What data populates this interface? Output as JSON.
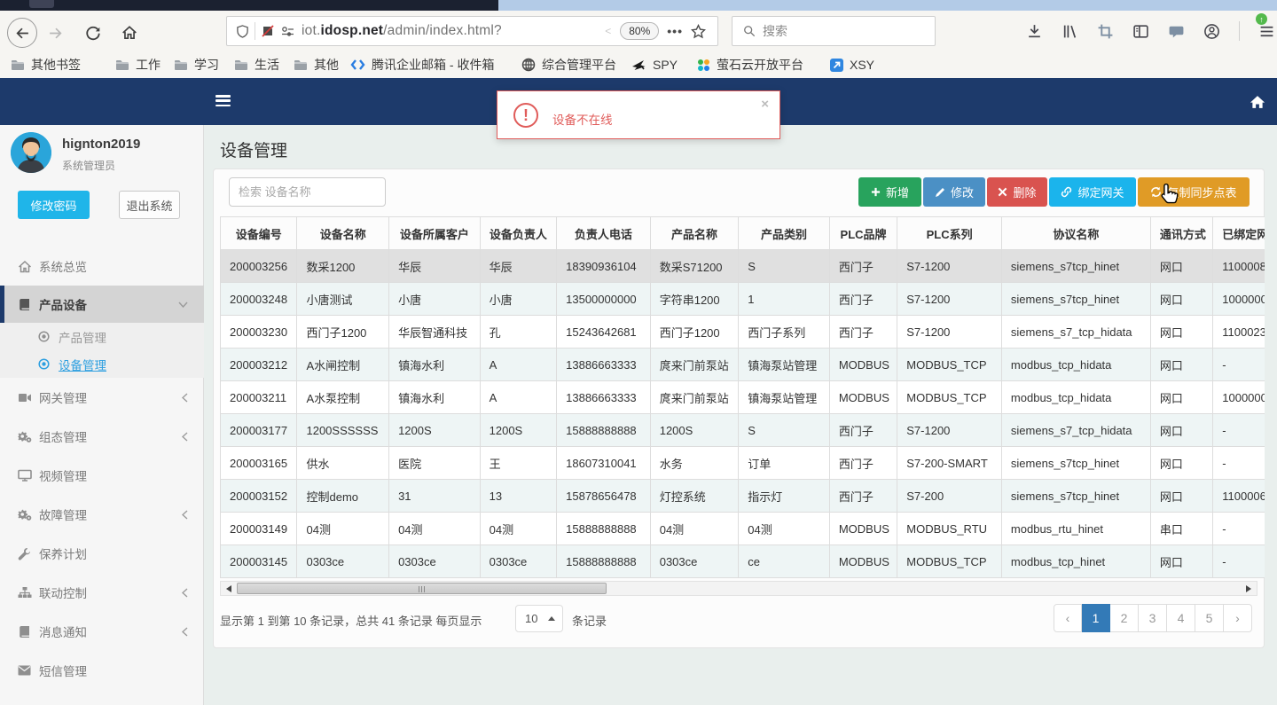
{
  "browser": {
    "url_prefix": "iot.",
    "url_host": "idosp.net",
    "url_path": "/admin/index.html?",
    "zoom_badge": "80%",
    "page_actions": "•••",
    "search_placeholder": "搜索",
    "bookmarks": [
      {
        "label": "其他书签",
        "icon": "folder"
      },
      {
        "label": "工作",
        "icon": "folder"
      },
      {
        "label": "学习",
        "icon": "folder"
      },
      {
        "label": "生活",
        "icon": "folder"
      },
      {
        "label": "其他",
        "icon": "folder"
      },
      {
        "label": "腾讯企业邮箱 - 收件箱",
        "icon": "tencent"
      },
      {
        "label": "综合管理平台",
        "icon": "globe"
      },
      {
        "label": "SPY",
        "icon": "plane"
      },
      {
        "label": "萤石云开放平台",
        "icon": "dots"
      },
      {
        "label": "XSY",
        "icon": "bluesq"
      }
    ]
  },
  "alert": {
    "message": "设备不在线",
    "close": "×"
  },
  "user": {
    "name": "hignton2019",
    "role": "系统管理员",
    "change_password": "修改密码",
    "logout": "退出系统"
  },
  "sidebar": {
    "items": [
      {
        "label": "系统总览",
        "icon": "home"
      },
      {
        "label": "产品设备",
        "icon": "book",
        "state": "expanded",
        "children": [
          {
            "label": "产品管理",
            "active": false
          },
          {
            "label": "设备管理",
            "active": true
          }
        ]
      },
      {
        "label": "网关管理",
        "icon": "gateway",
        "state": "collapsed"
      },
      {
        "label": "组态管理",
        "icon": "gears",
        "state": "collapsed"
      },
      {
        "label": "视频管理",
        "icon": "monitor"
      },
      {
        "label": "故障管理",
        "icon": "gears",
        "state": "collapsed"
      },
      {
        "label": "保养计划",
        "icon": "wrench"
      },
      {
        "label": "联动控制",
        "icon": "sitemap",
        "state": "collapsed"
      },
      {
        "label": "消息通知",
        "icon": "book",
        "state": "collapsed"
      },
      {
        "label": "短信管理",
        "icon": "envelope"
      }
    ]
  },
  "page": {
    "title": "设备管理",
    "search_placeholder": "检索 设备名称"
  },
  "toolbar": {
    "add": "新增",
    "edit": "修改",
    "delete": "删除",
    "bind": "绑定网关",
    "copy": "复制同步点表",
    "colors": {
      "add": "#28a35d",
      "edit": "#4b90c5",
      "delete": "#d9534f",
      "bind": "#1bb4ec",
      "copy": "#e09b26"
    }
  },
  "table": {
    "columns": [
      "设备编号",
      "设备名称",
      "设备所属客户",
      "设备负责人",
      "负责人电话",
      "产品名称",
      "产品类别",
      "PLC品牌",
      "PLC系列",
      "协议名称",
      "通讯方式",
      "已绑定网关"
    ],
    "rows": [
      [
        "200003256",
        "数采1200",
        "华辰",
        "华辰",
        "18390936104",
        "数采S71200",
        "S",
        "西门子",
        "S7-1200",
        "siemens_s7tcp_hinet",
        "网口",
        "1100008"
      ],
      [
        "200003248",
        "小唐测试",
        "小唐",
        "小唐",
        "13500000000",
        "字符串1200",
        "1",
        "西门子",
        "S7-1200",
        "siemens_s7tcp_hinet",
        "网口",
        "1000000"
      ],
      [
        "200003230",
        "西门子1200",
        "华辰智通科技",
        "孔",
        "15243642681",
        "西门子1200",
        "西门子系列",
        "西门子",
        "S7-1200",
        "siemens_s7_tcp_hidata",
        "网口",
        "1100023"
      ],
      [
        "200003212",
        "A水闸控制",
        "镇海水利",
        "A",
        "13886663333",
        "庹来门前泵站",
        "镇海泵站管理",
        "MODBUS",
        "MODBUS_TCP",
        "modbus_tcp_hidata",
        "网口",
        "-"
      ],
      [
        "200003211",
        "A水泵控制",
        "镇海水利",
        "A",
        "13886663333",
        "庹来门前泵站",
        "镇海泵站管理",
        "MODBUS",
        "MODBUS_TCP",
        "modbus_tcp_hidata",
        "网口",
        "1000000"
      ],
      [
        "200003177",
        "1200SSSSSS",
        "1200S",
        "1200S",
        "15888888888",
        "1200S",
        "S",
        "西门子",
        "S7-1200",
        "siemens_s7_tcp_hidata",
        "网口",
        "-"
      ],
      [
        "200003165",
        "供水",
        "医院",
        "王",
        "18607310041",
        "水务",
        "订单",
        "西门子",
        "S7-200-SMART",
        "siemens_s7tcp_hinet",
        "网口",
        "-"
      ],
      [
        "200003152",
        "控制demo",
        "31",
        "13",
        "15878656478",
        "灯控系统",
        "指示灯",
        "西门子",
        "S7-200",
        "siemens_s7tcp_hinet",
        "网口",
        "1100006"
      ],
      [
        "200003149",
        "04测",
        "04测",
        "04测",
        "15888888888",
        "04测",
        "04测",
        "MODBUS",
        "MODBUS_RTU",
        "modbus_rtu_hinet",
        "串口",
        "-"
      ],
      [
        "200003145",
        "0303ce",
        "0303ce",
        "0303ce",
        "15888888888",
        "0303ce",
        "ce",
        "MODBUS",
        "MODBUS_TCP",
        "modbus_tcp_hinet",
        "网口",
        "-"
      ]
    ],
    "selected_row": 0
  },
  "pagination": {
    "info": "显示第 1 到第 10 条记录，总共 41 条记录 每页显示",
    "page_size": "10",
    "suffix": "条记录",
    "pages": [
      "1",
      "2",
      "3",
      "4",
      "5"
    ],
    "active_page": "1",
    "prev": "‹",
    "next": "›"
  }
}
